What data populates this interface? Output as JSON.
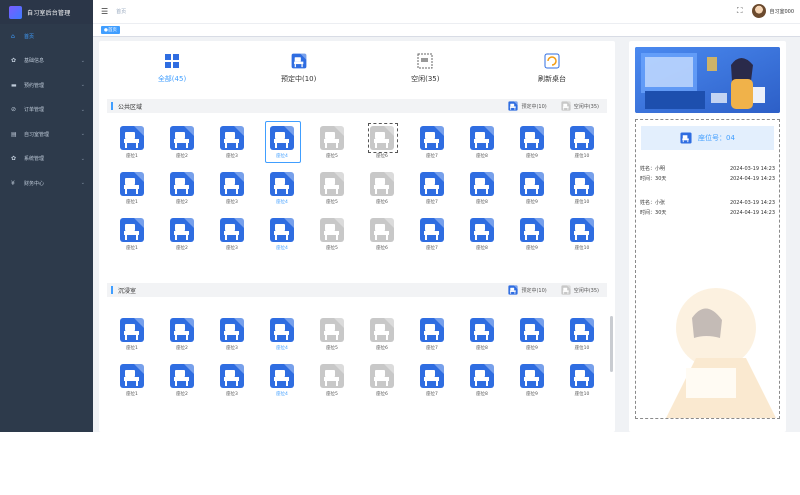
{
  "app": {
    "title": "自习室后台管理"
  },
  "sidebar": {
    "items": [
      {
        "label": "首页",
        "icon": "home-icon",
        "glyph": "⌂",
        "active": true,
        "arrow": ""
      },
      {
        "label": "基础信息",
        "icon": "gear-icon",
        "glyph": "✿",
        "active": false,
        "arrow": "⌄"
      },
      {
        "label": "预约管理",
        "icon": "folder-icon",
        "glyph": "▬",
        "active": false,
        "arrow": "⌄"
      },
      {
        "label": "订单管理",
        "icon": "order-icon",
        "glyph": "⊘",
        "active": false,
        "arrow": "⌄"
      },
      {
        "label": "自习室管理",
        "icon": "room-icon",
        "glyph": "▤",
        "active": false,
        "arrow": "⌄"
      },
      {
        "label": "系统管理",
        "icon": "settings-icon",
        "glyph": "✿",
        "active": false,
        "arrow": "⌄"
      },
      {
        "label": "财务中心",
        "icon": "yen-icon",
        "glyph": "¥",
        "active": false,
        "arrow": "⌄"
      }
    ]
  },
  "header": {
    "breadcrumb": "首页",
    "user": "自习室000",
    "tab": "首页"
  },
  "filters": [
    {
      "label": "全部(45)",
      "active": true
    },
    {
      "label": "预定中(10)",
      "active": false
    },
    {
      "label": "空闲(35)",
      "active": false
    },
    {
      "label": "刷新桌台",
      "active": false
    }
  ],
  "sections": [
    {
      "title": "公共区域",
      "reserved": "预定中(10)",
      "free": "空闲中(35)",
      "rows": 3
    },
    {
      "title": "沉浸室",
      "reserved": "预定中(10)",
      "free": "空闲中(35)",
      "rows": 2
    }
  ],
  "seat_labels": [
    "座位1",
    "座位2",
    "座位3",
    "座位4",
    "座位5",
    "座位6",
    "座位7",
    "座位8",
    "座位9",
    "座位10"
  ],
  "seat_status": [
    "booked",
    "booked",
    "booked",
    "booked",
    "free",
    "free",
    "booked",
    "booked",
    "booked",
    "booked"
  ],
  "selected_seat": {
    "section": 0,
    "row": 0,
    "col": 3
  },
  "dashed_seat": {
    "section": 0,
    "row": 0,
    "col": 5
  },
  "detail": {
    "seat_no": "座位号：04",
    "records": [
      {
        "name_label": "姓名：",
        "name": "小明",
        "time_label": "时间：",
        "duration": "30天",
        "start": "2024-03-19 14:23",
        "end": "2024-04-19 14:23"
      },
      {
        "name_label": "姓名：",
        "name": "小张",
        "time_label": "时间：",
        "duration": "30天",
        "start": "2024-03-19 14:23",
        "end": "2024-04-19 14:23"
      }
    ]
  },
  "colors": {
    "accent": "#409eff",
    "booked": "#2f6de1",
    "free": "#c8c8c8",
    "sidebar": "#2d3a4b"
  }
}
